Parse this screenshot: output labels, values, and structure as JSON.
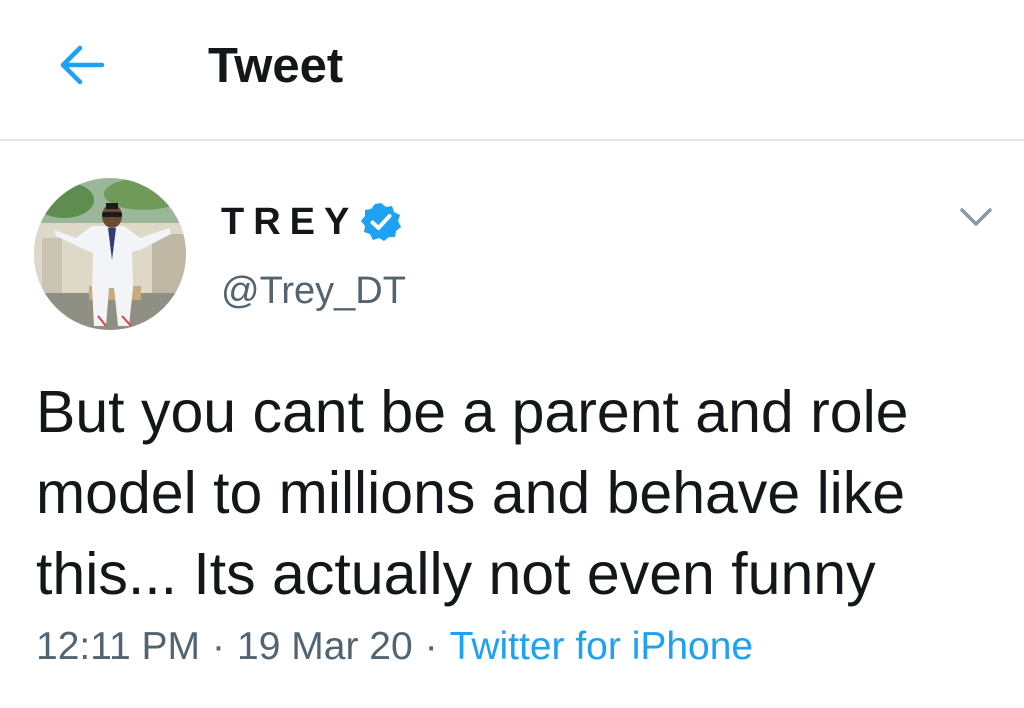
{
  "header": {
    "title": "Tweet",
    "back_icon": "arrow-left-icon"
  },
  "tweet": {
    "author": {
      "display_name": "TREY",
      "handle": "@Trey_DT",
      "verified": true,
      "verified_icon": "verified-badge-icon"
    },
    "menu_icon": "chevron-down-icon",
    "text": "But you cant be a parent and role model to millions and behave like this... Its actually not even funny",
    "time": "12:11 PM",
    "separator": "·",
    "date": "19 Mar 20",
    "source": "Twitter for iPhone"
  },
  "colors": {
    "accent": "#1da1f2",
    "text": "#14171a",
    "secondary_text": "#536471",
    "divider": "#e1e8ed"
  }
}
